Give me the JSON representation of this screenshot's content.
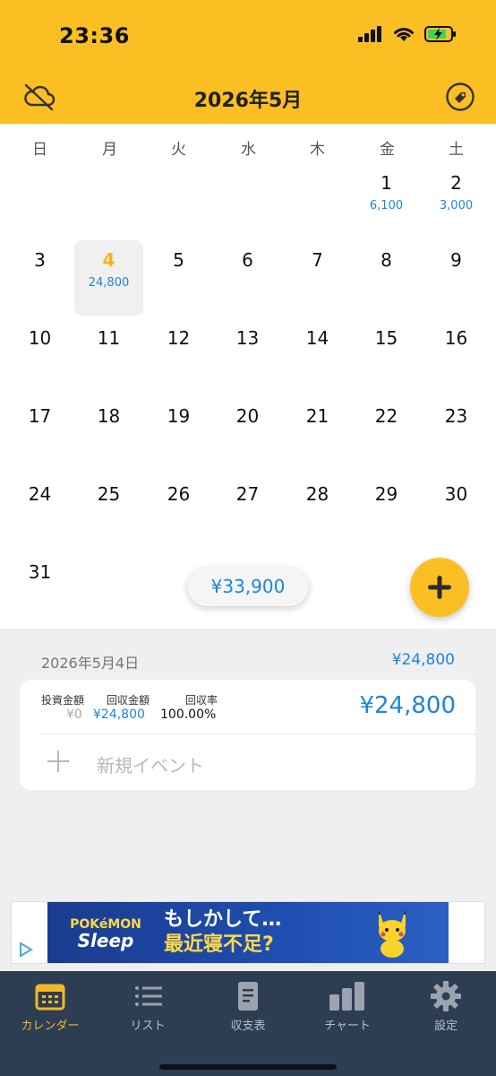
{
  "status_bar": {
    "time": "23:36"
  },
  "header": {
    "title": "2026年5月",
    "left_icon": "cloud-off-icon",
    "right_icon": "tag-icon",
    "background": "#fbbf24"
  },
  "weekdays": [
    "日",
    "月",
    "火",
    "水",
    "木",
    "金",
    "土"
  ],
  "days": [
    {
      "d": "1",
      "amt": "6,100"
    },
    {
      "d": "2",
      "amt": "3,000"
    },
    {
      "d": "3",
      "amt": ""
    },
    {
      "d": "4",
      "amt": "24,800",
      "today": true
    },
    {
      "d": "5",
      "amt": ""
    },
    {
      "d": "6",
      "amt": ""
    },
    {
      "d": "7",
      "amt": ""
    },
    {
      "d": "8",
      "amt": ""
    },
    {
      "d": "9",
      "amt": ""
    },
    {
      "d": "10",
      "amt": ""
    },
    {
      "d": "11",
      "amt": ""
    },
    {
      "d": "12",
      "amt": ""
    },
    {
      "d": "13",
      "amt": ""
    },
    {
      "d": "14",
      "amt": ""
    },
    {
      "d": "15",
      "amt": ""
    },
    {
      "d": "16",
      "amt": ""
    },
    {
      "d": "17",
      "amt": ""
    },
    {
      "d": "18",
      "amt": ""
    },
    {
      "d": "19",
      "amt": ""
    },
    {
      "d": "20",
      "amt": ""
    },
    {
      "d": "21",
      "amt": ""
    },
    {
      "d": "22",
      "amt": ""
    },
    {
      "d": "23",
      "amt": ""
    },
    {
      "d": "24",
      "amt": ""
    },
    {
      "d": "25",
      "amt": ""
    },
    {
      "d": "26",
      "amt": ""
    },
    {
      "d": "27",
      "amt": ""
    },
    {
      "d": "28",
      "amt": ""
    },
    {
      "d": "29",
      "amt": ""
    },
    {
      "d": "30",
      "amt": ""
    },
    {
      "d": "31",
      "amt": ""
    }
  ],
  "month_total": "¥33,900",
  "selected": {
    "date": "2026年5月4日",
    "total": "¥24,800",
    "invest_label": "投資金額",
    "invest_value": "¥0",
    "return_label": "回収金額",
    "return_value": "¥24,800",
    "rate_label": "回収率",
    "rate_value": "100.00%",
    "card_total": "¥24,800",
    "new_event": "新規イベント"
  },
  "ad": {
    "brand_top": "POKéMON",
    "brand_bottom": "Sleep",
    "line1": "もしかして…",
    "line2": "最近寝不足?"
  },
  "tabs": [
    {
      "label": "カレンダー",
      "icon": "calendar-icon",
      "active": true
    },
    {
      "label": "リスト",
      "icon": "list-icon"
    },
    {
      "label": "収支表",
      "icon": "document-icon"
    },
    {
      "label": "チャート",
      "icon": "bar-chart-icon"
    },
    {
      "label": "設定",
      "icon": "gear-icon"
    }
  ],
  "colors": {
    "accent": "#fbbf24",
    "amount": "#1a86d9",
    "tabbar": "#2e3e52"
  }
}
